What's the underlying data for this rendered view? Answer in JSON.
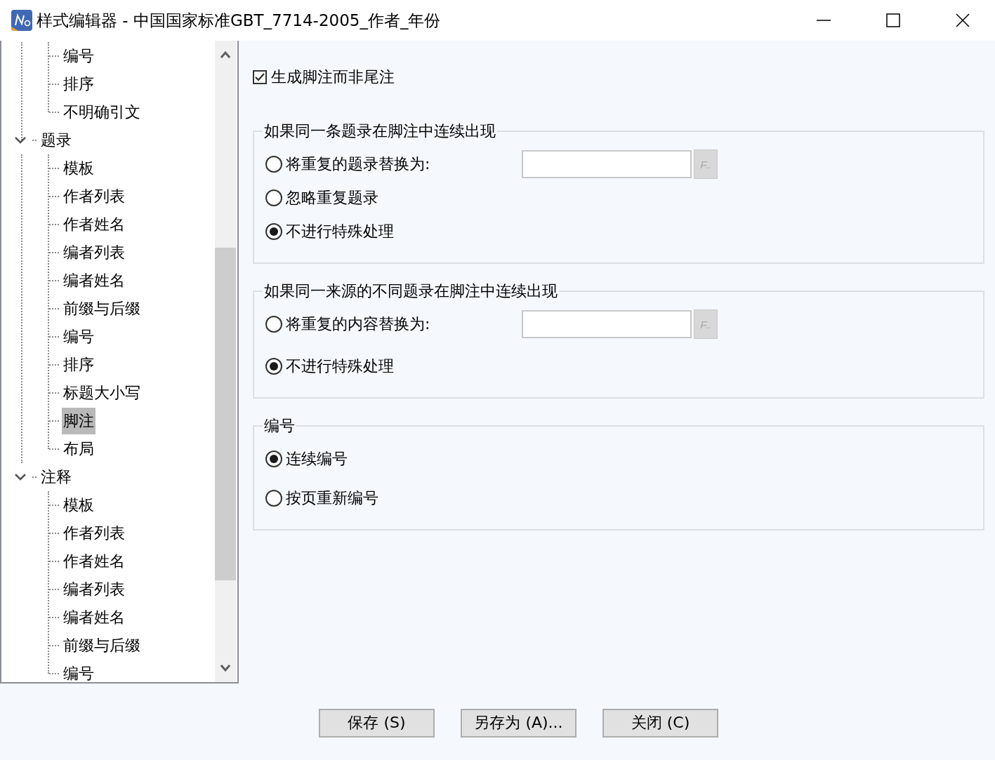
{
  "window": {
    "title": "样式编辑器 - 中国国家标准GBT_7714-2005_作者_年份"
  },
  "tree": [
    {
      "children": [
        {
          "label": "编号",
          "selected": false
        },
        {
          "label": "排序",
          "selected": false
        },
        {
          "label": "不明确引文",
          "selected": false
        }
      ]
    },
    {
      "label": "题录",
      "expanded": true,
      "children": [
        {
          "label": "模板",
          "selected": false
        },
        {
          "label": "作者列表",
          "selected": false
        },
        {
          "label": "作者姓名",
          "selected": false
        },
        {
          "label": "编者列表",
          "selected": false
        },
        {
          "label": "编者姓名",
          "selected": false
        },
        {
          "label": "前缀与后缀",
          "selected": false
        },
        {
          "label": "编号",
          "selected": false
        },
        {
          "label": "排序",
          "selected": false
        },
        {
          "label": "标题大小写",
          "selected": false
        },
        {
          "label": "脚注",
          "selected": true
        },
        {
          "label": "布局",
          "selected": false
        }
      ]
    },
    {
      "label": "注释",
      "expanded": true,
      "children": [
        {
          "label": "模板",
          "selected": false
        },
        {
          "label": "作者列表",
          "selected": false
        },
        {
          "label": "作者姓名",
          "selected": false
        },
        {
          "label": "编者列表",
          "selected": false
        },
        {
          "label": "编者姓名",
          "selected": false
        },
        {
          "label": "前缀与后缀",
          "selected": false
        },
        {
          "label": "编号",
          "selected": false
        }
      ]
    }
  ],
  "footnote_checkbox": {
    "label": "生成脚注而非尾注",
    "checked": true
  },
  "groups": [
    {
      "title": "如果同一条题录在脚注中连续出现",
      "options": [
        {
          "label": "将重复的题录替换为:",
          "selected": false,
          "field": {
            "button": "F.."
          }
        },
        {
          "label": "忽略重复题录",
          "selected": false
        },
        {
          "label": "不进行特殊处理",
          "selected": true
        }
      ]
    },
    {
      "title": "如果同一来源的不同题录在脚注中连续出现",
      "options": [
        {
          "label": "将重复的内容替换为:",
          "selected": false,
          "field": {
            "button": "F.."
          }
        },
        {
          "label": "不进行特殊处理",
          "selected": true
        }
      ]
    },
    {
      "title": "编号",
      "options": [
        {
          "label": "连续编号",
          "selected": true
        },
        {
          "label": "按页重新编号",
          "selected": false
        }
      ]
    }
  ],
  "buttons": [
    "保存 (S)",
    "另存为 (A)...",
    "关闭 (C)"
  ]
}
